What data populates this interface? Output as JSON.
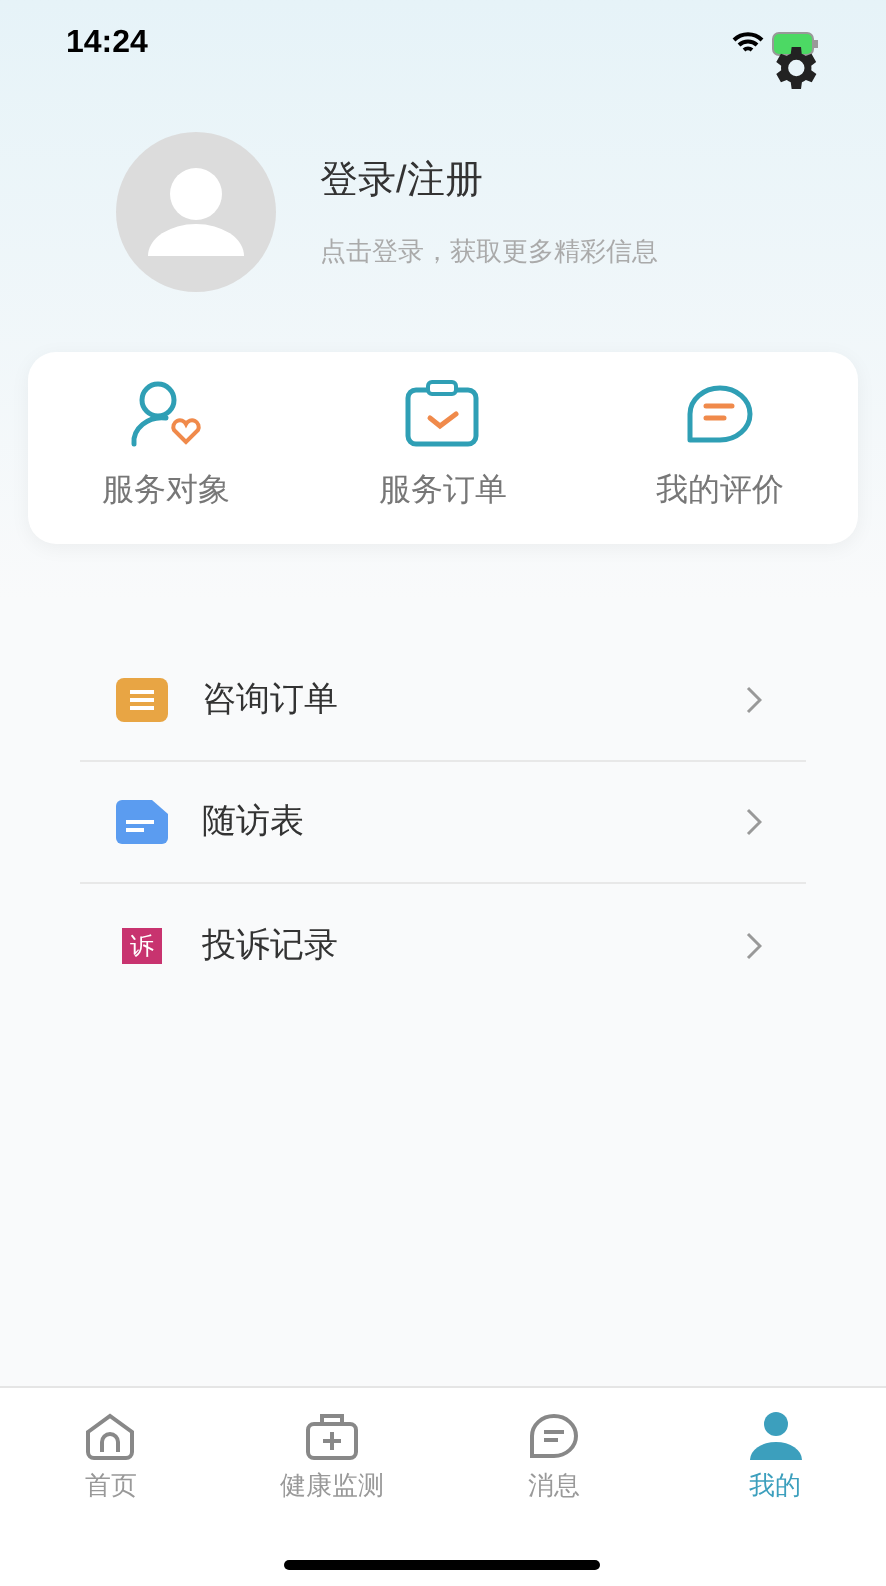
{
  "status_bar": {
    "time": "14:24"
  },
  "profile": {
    "title": "登录/注册",
    "subtitle": "点击登录，获取更多精彩信息"
  },
  "shortcuts": [
    {
      "kind": "person",
      "label": "服务对象"
    },
    {
      "kind": "clipboard",
      "label": "服务订单"
    },
    {
      "kind": "chat",
      "label": "我的评价"
    }
  ],
  "menu": [
    {
      "kind": "orders",
      "label": "咨询订单"
    },
    {
      "kind": "form",
      "label": "随访表"
    },
    {
      "kind": "complaint",
      "label": "投诉记录",
      "icon_text": "诉"
    }
  ],
  "tab_bar": [
    {
      "kind": "home",
      "label": "首页",
      "selected": false
    },
    {
      "kind": "kit",
      "label": "健康监测",
      "selected": false
    },
    {
      "kind": "message",
      "label": "消息",
      "selected": false
    },
    {
      "kind": "me",
      "label": "我的",
      "selected": true
    }
  ]
}
